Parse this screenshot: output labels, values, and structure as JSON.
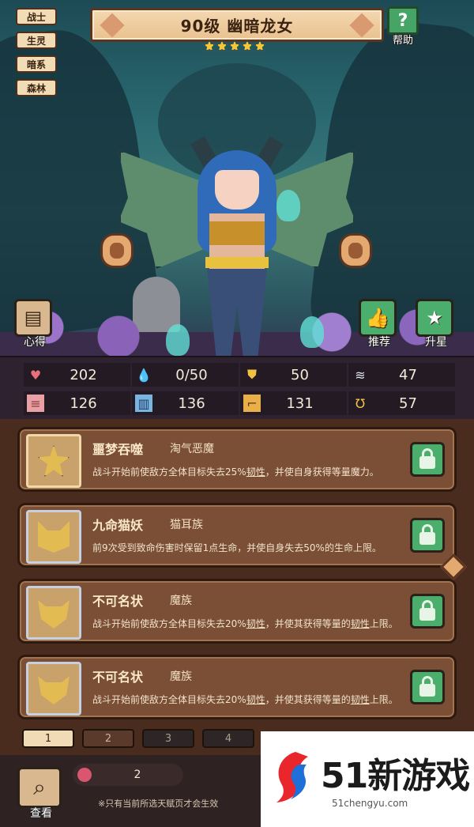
{
  "hero": {
    "title": "90级 幽暗龙女",
    "star_count": 5,
    "tags": [
      "战士",
      "生灵",
      "暗系",
      "森林"
    ]
  },
  "buttons": {
    "help": "帮助",
    "heart": "心得",
    "recommend": "推荐",
    "star_up": "升星",
    "view": "查看"
  },
  "stats": [
    {
      "icon": "heart-icon",
      "value": "202"
    },
    {
      "icon": "water-drop-icon",
      "value": "0/50"
    },
    {
      "icon": "shield-icon",
      "value": "50"
    },
    {
      "icon": "wing-icon",
      "value": "47"
    },
    {
      "icon": "claw-icon",
      "value": "126"
    },
    {
      "icon": "book-icon",
      "value": "136"
    },
    {
      "icon": "boot-icon",
      "value": "131"
    },
    {
      "icon": "horseshoe-icon",
      "value": "57"
    }
  ],
  "talents": [
    {
      "name": "噩梦吞噬",
      "race": "淘气恶魔",
      "desc_a": "战斗开始前使敌方全体目标失去25%",
      "kw1": "韧性",
      "desc_b": "，并使自身获得等量魔力。",
      "kw2": "",
      "desc_c": ""
    },
    {
      "name": "九命猫妖",
      "race": "猫耳族",
      "desc_a": "前9次受到致命伤害时保留1点生命，并使自身失去50%的生命上限。",
      "kw1": "",
      "desc_b": "",
      "kw2": "",
      "desc_c": ""
    },
    {
      "name": "不可名状",
      "race": "魔族",
      "desc_a": "战斗开始前使敌方全体目标失去20%",
      "kw1": "韧性",
      "desc_b": "，并使其获得等量的",
      "kw2": "韧性",
      "desc_c": "上限。"
    },
    {
      "name": "不可名状",
      "race": "魔族",
      "desc_a": "战斗开始前使敌方全体目标失去20%",
      "kw1": "韧性",
      "desc_b": "，并使其获得等量的",
      "kw2": "韧性",
      "desc_c": "上限。"
    }
  ],
  "pages": [
    "1",
    "2",
    "3",
    "4"
  ],
  "fruit_count": "2",
  "note": "※只有当前所选天赋页才会生效",
  "watermark": {
    "title": "51新游戏",
    "url": "51chengyu.com"
  },
  "colors": {
    "accent_green": "#4cae6c",
    "banner": "#f4d8b0",
    "panel": "#4a2c1e"
  }
}
